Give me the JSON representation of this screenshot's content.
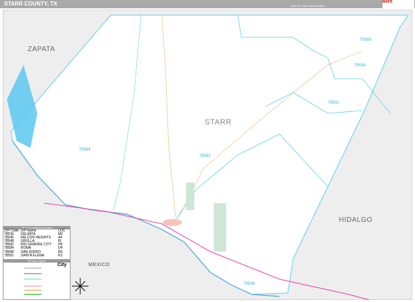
{
  "header": {
    "title": "STARR COUNTY, TX",
    "edition": "2020 ZIP Code Premium Edition",
    "logo_text": "MAPS"
  },
  "map": {
    "neighbors": [
      "ZAPATA",
      "HIDALGO",
      "MEXICO"
    ],
    "county": "STARR",
    "zips": [
      "78588",
      "78536",
      "78591",
      "78584",
      "78582",
      "78548"
    ],
    "colors": {
      "zip_boundary": "#5ad0e8",
      "county_fill": "#ffffff",
      "outside": "#eeeeee",
      "highway": "#e83fa4",
      "roads": "#f3c48b",
      "water": "#5bc8f0"
    }
  },
  "index": {
    "title": "ZIP Code Index/Grid Locator",
    "headers": [
      "ZIP Code",
      "ZIP Name",
      "LOC"
    ],
    "rows": [
      [
        "78536",
        "DELMITA",
        "M2"
      ],
      [
        "78545",
        "FALCON HEIGHTS",
        "A4"
      ],
      [
        "78548",
        "GRULLA",
        "I8"
      ],
      [
        "78582",
        "RIO GRANDE CITY",
        "H5"
      ],
      [
        "78584",
        "ROMA",
        "D4"
      ],
      [
        "78588",
        "SAN ISIDRO",
        "M1"
      ],
      [
        "78591",
        "SANTA ELENA",
        "K3"
      ]
    ]
  },
  "legend": {
    "title": "ZIP Map Legend",
    "city_label": "City"
  }
}
